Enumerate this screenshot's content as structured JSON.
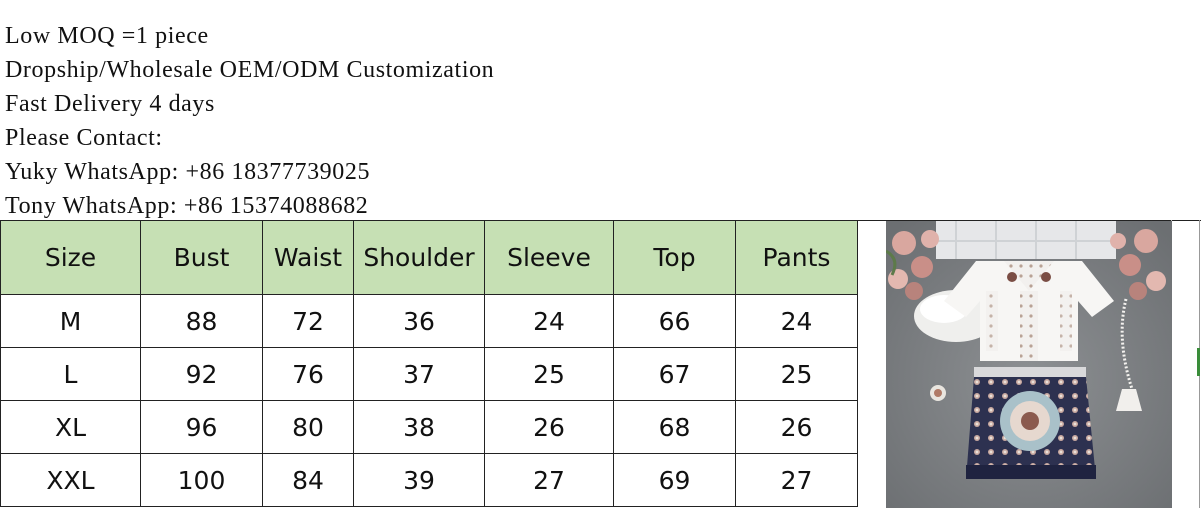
{
  "info_lines": [
    "Low MOQ =1 piece",
    "Dropship/Wholesale OEM/ODM Customization",
    "Fast Delivery 4 days",
    "Please Contact:",
    "Yuky WhatsApp: +86 18377739025",
    "Tony WhatsApp: +86 15374088682"
  ],
  "table": {
    "headers": [
      "Size",
      "Bust",
      "Waist",
      "Shoulder",
      "Sleeve",
      "Top",
      "Pants"
    ],
    "rows": [
      [
        "M",
        "88",
        "72",
        "36",
        "24",
        "66",
        "24"
      ],
      [
        "L",
        "92",
        "76",
        "37",
        "25",
        "67",
        "25"
      ],
      [
        "XL",
        "96",
        "80",
        "38",
        "26",
        "68",
        "26"
      ],
      [
        "XXL",
        "100",
        "84",
        "39",
        "27",
        "69",
        "27"
      ]
    ]
  },
  "colors": {
    "header_bg": "#c6e0b4",
    "border": "#222222"
  },
  "photo": {
    "subject": "white embroidered short-sleeve blouse with printed paisley mini skirt on gray rug",
    "icon": "product-photo"
  }
}
